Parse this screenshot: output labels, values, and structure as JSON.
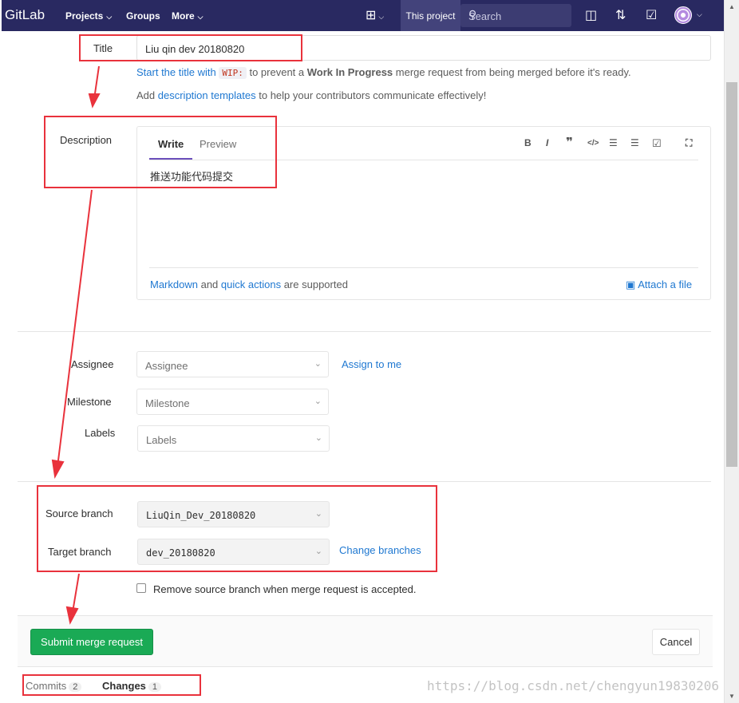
{
  "navbar": {
    "logo": "GitLab",
    "projects": "Projects",
    "groups": "Groups",
    "more": "More",
    "this_project": "This project",
    "search_placeholder": "Search"
  },
  "form": {
    "title_label": "Title",
    "title_value": "Liu qin dev 20180820",
    "wip_hint_prefix": "Start the title with",
    "wip_code": "WIP:",
    "wip_hint_mid": "to prevent a",
    "wip_hint_bold": "Work In Progress",
    "wip_hint_suffix": "merge request from being merged before it's ready.",
    "templates_prefix": "Add",
    "templates_link": "description templates",
    "templates_suffix": "to help your contributors communicate effectively!",
    "description_label": "Description",
    "editor": {
      "write_tab": "Write",
      "preview_tab": "Preview",
      "text": "推送功能代码提交",
      "markdown_link": "Markdown",
      "footer_and": "and",
      "quick_actions_link": "quick actions",
      "footer_suffix": "are supported",
      "attach_label": "Attach a file"
    },
    "assignee_label": "Assignee",
    "assignee_placeholder": "Assignee",
    "assign_to_me": "Assign to me",
    "milestone_label": "Milestone",
    "milestone_placeholder": "Milestone",
    "labels_label": "Labels",
    "labels_placeholder": "Labels",
    "source_branch_label": "Source branch",
    "source_branch_value": "LiuQin_Dev_20180820",
    "target_branch_label": "Target branch",
    "target_branch_value": "dev_20180820",
    "change_branches": "Change branches",
    "remove_source_label": "Remove source branch when merge request is accepted.",
    "submit_label": "Submit merge request",
    "cancel_label": "Cancel"
  },
  "tabs": {
    "commits_label": "Commits",
    "commits_count": "2",
    "changes_label": "Changes",
    "changes_count": "1"
  },
  "watermark": "https://blog.csdn.net/chengyun19830206",
  "colors": {
    "navbar": "#292961",
    "link": "#1f78d1",
    "submit": "#1aaa55",
    "annotation": "#e9323c"
  }
}
